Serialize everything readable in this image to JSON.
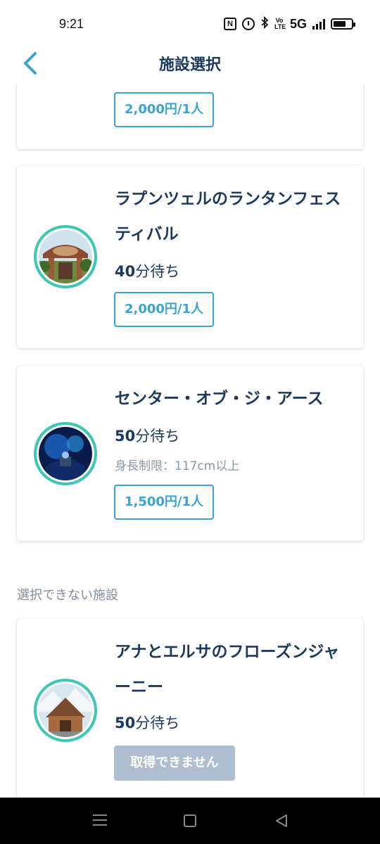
{
  "status_bar": {
    "time": "9:21",
    "network": "5G",
    "volte": "Vo LTE",
    "nfc": "N"
  },
  "header": {
    "title": "施設選択"
  },
  "cards": [
    {
      "price": "2,000円/1人"
    },
    {
      "name": "ラプンツェルのランタンフェスティバル",
      "wait_number": "40",
      "wait_unit": "分待ち",
      "price": "2,000円/1人"
    },
    {
      "name": "センター・オブ・ジ・アース",
      "wait_number": "50",
      "wait_unit": "分待ち",
      "height_limit": "身長制限：117cm以上",
      "price": "1,500円/1人"
    }
  ],
  "unavailable_section": {
    "label": "選択できない施設",
    "cards": [
      {
        "name": "アナとエルサのフローズンジャーニー",
        "wait_number": "50",
        "wait_unit": "分待ち",
        "button": "取得できません"
      }
    ]
  },
  "colors": {
    "accent": "#3aa3cf",
    "title_text": "#1d3a5c",
    "thumb_ring": "#3cc8b4",
    "disabled_button": "#aebdd0"
  }
}
